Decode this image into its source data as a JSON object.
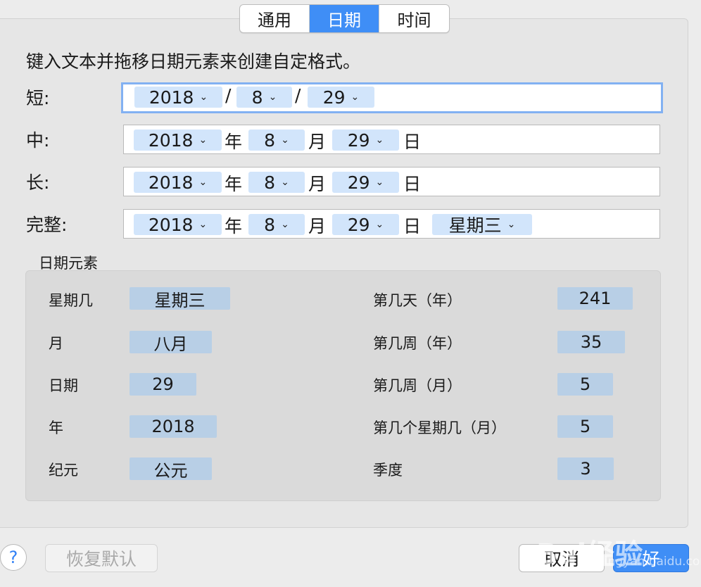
{
  "tabs": [
    "通用",
    "日期",
    "时间"
  ],
  "active_tab": "日期",
  "instruction": "键入文本并拖移日期元素来创建自定格式。",
  "formats": {
    "short": {
      "label": "短:",
      "year": "2018",
      "month": "8",
      "day": "29",
      "sep1": "/",
      "sep2": "/"
    },
    "medium": {
      "label": "中:",
      "year": "2018",
      "month": "8",
      "day": "29",
      "sep1": "年",
      "sep2": "月",
      "sep3": "日"
    },
    "long": {
      "label": "长:",
      "year": "2018",
      "month": "8",
      "day": "29",
      "sep1": "年",
      "sep2": "月",
      "sep3": "日"
    },
    "full": {
      "label": "完整:",
      "year": "2018",
      "month": "8",
      "day": "29",
      "sep1": "年",
      "sep2": "月",
      "sep3": "日",
      "weekday": "星期三"
    }
  },
  "chevron": "⌄",
  "elements_title": "日期元素",
  "elements_left": [
    {
      "label": "星期几",
      "value": "星期三"
    },
    {
      "label": "月",
      "value": "八月"
    },
    {
      "label": "日期",
      "value": "29"
    },
    {
      "label": "年",
      "value": "2018"
    },
    {
      "label": "纪元",
      "value": "公元"
    }
  ],
  "elements_right": [
    {
      "label": "第几天（年）",
      "value": "241"
    },
    {
      "label": "第几周（年）",
      "value": "35"
    },
    {
      "label": "第几周（月）",
      "value": "5"
    },
    {
      "label": "第几个星期几（月）",
      "value": "5"
    },
    {
      "label": "季度",
      "value": "3"
    }
  ],
  "buttons": {
    "help": "?",
    "reset": "恢复默认",
    "cancel": "取消",
    "ok": "好"
  },
  "watermark": {
    "text": "Bai经验",
    "sub": "jingyan.baidu.com"
  },
  "colors": {
    "accent": "#3f8ef6",
    "token": "#d2e5fb",
    "element_chip": "#b8cfe6"
  }
}
